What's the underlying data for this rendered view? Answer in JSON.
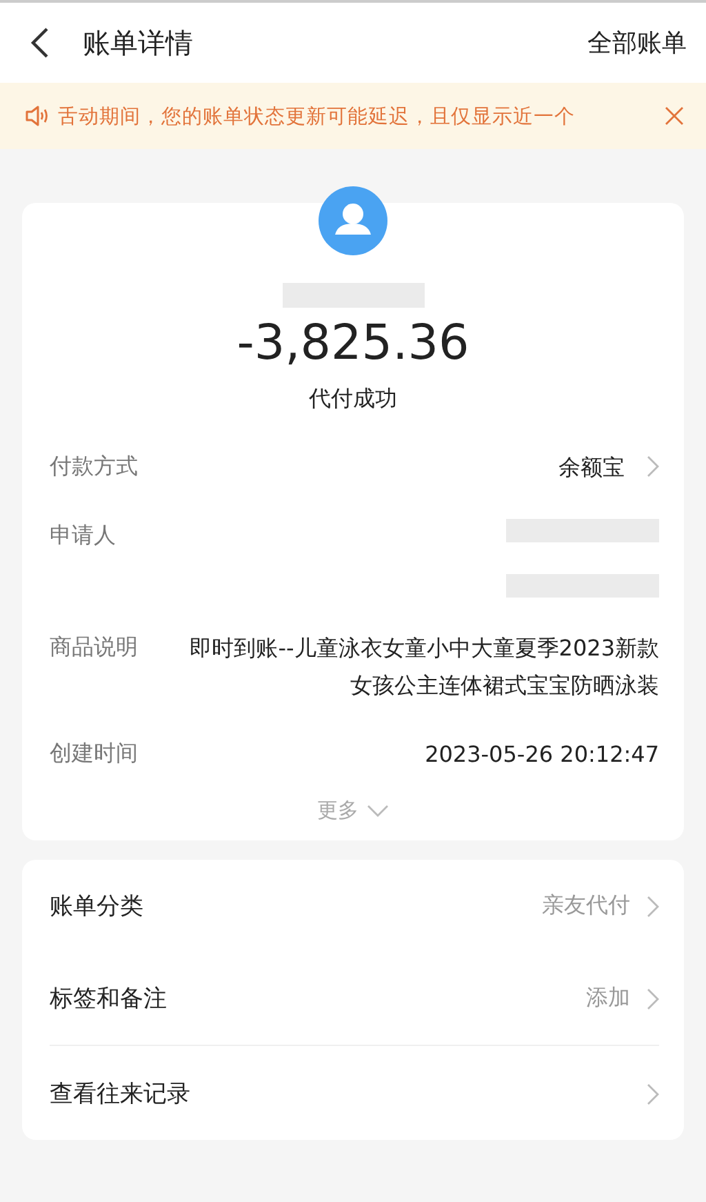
{
  "header": {
    "title": "账单详情",
    "action": "全部账单"
  },
  "notice": {
    "text": "舌动期间，您的账单状态更新可能延迟，且仅显示近一个"
  },
  "summary": {
    "amount": "-3,825.36",
    "status": "代付成功"
  },
  "details": [
    {
      "kind": "text",
      "label": "付款方式",
      "value": "余额宝",
      "arrow": true
    },
    {
      "kind": "redacted",
      "label": "申请人",
      "arrow": false
    },
    {
      "kind": "text",
      "label": "商品说明",
      "value": "即时到账--儿童泳衣女童小中大童夏季2023新款女孩公主连体裙式宝宝防晒泳装",
      "arrow": false
    },
    {
      "kind": "text",
      "label": "创建时间",
      "value": "2023-05-26 20:12:47",
      "arrow": false
    }
  ],
  "more": {
    "label": "更多",
    "expanded": false
  },
  "actions": [
    {
      "label": "账单分类",
      "value": "亲友代付"
    },
    {
      "label": "标签和备注",
      "value": "添加"
    },
    {
      "label": "查看往来记录"
    }
  ]
}
